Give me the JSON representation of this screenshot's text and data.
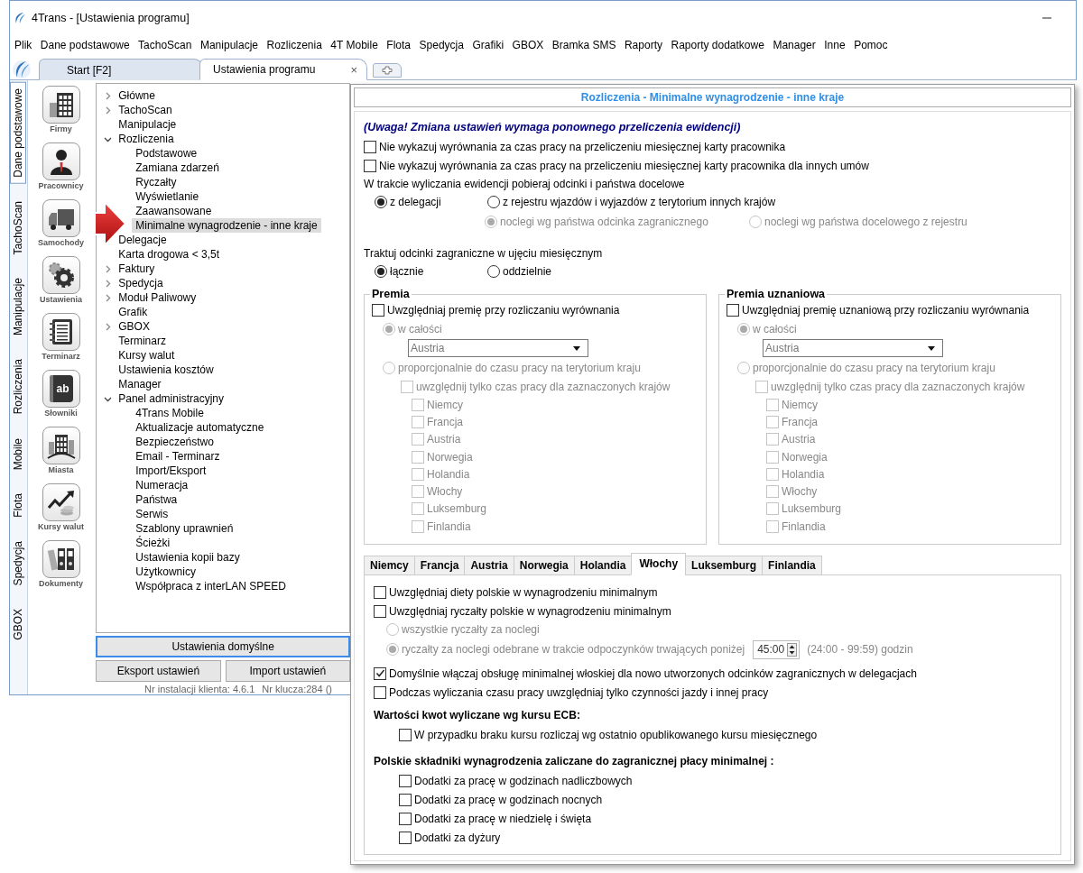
{
  "window": {
    "title": "4Trans - [Ustawienia programu]"
  },
  "menu": [
    "Plik",
    "Dane podstawowe",
    "TachoScan",
    "Manipulacje",
    "Rozliczenia",
    "4T Mobile",
    "Flota",
    "Spedycja",
    "Grafiki",
    "GBOX",
    "Bramka SMS",
    "Raporty",
    "Raporty dodatkowe",
    "Manager",
    "Inne",
    "Pomoc"
  ],
  "tabs": [
    {
      "label": "Start [F2]",
      "selected": false
    },
    {
      "label": "Ustawienia programu",
      "selected": true,
      "close": "×"
    }
  ],
  "side_tabs": [
    {
      "label": "Dane podstawowe",
      "selected": true
    },
    {
      "label": "TachoScan",
      "selected": false
    },
    {
      "label": "Manipulacje",
      "selected": false
    },
    {
      "label": "Rozliczenia",
      "selected": false
    },
    {
      "label": "Mobile",
      "selected": false
    },
    {
      "label": "Flota",
      "selected": false
    },
    {
      "label": "Spedycja",
      "selected": false
    },
    {
      "label": "GBOX",
      "selected": false
    }
  ],
  "modules": [
    {
      "label": "Firmy",
      "kind": "building"
    },
    {
      "label": "Pracownicy",
      "kind": "person"
    },
    {
      "label": "Samochody",
      "kind": "truck"
    },
    {
      "label": "Ustawienia",
      "kind": "gear"
    },
    {
      "label": "Terminarz",
      "kind": "notebook"
    },
    {
      "label": "Słowniki",
      "kind": "book",
      "badge": "ab"
    },
    {
      "label": "Miasta",
      "kind": "city"
    },
    {
      "label": "Kursy walut",
      "kind": "chart"
    },
    {
      "label": "Dokumenty",
      "kind": "binders"
    }
  ],
  "tree": [
    {
      "label": "Główne",
      "expanded": false,
      "selected": false
    },
    {
      "label": "TachoScan",
      "expanded": false,
      "selected": false
    },
    {
      "label": "Manipulacje",
      "selected": false
    },
    {
      "label": "Rozliczenia",
      "expanded": true,
      "selected": false,
      "children": [
        {
          "label": "Podstawowe",
          "selected": false
        },
        {
          "label": "Zamiana zdarzeń",
          "selected": false
        },
        {
          "label": "Ryczałty",
          "selected": false
        },
        {
          "label": "Wyświetlanie",
          "selected": false
        },
        {
          "label": "Zaawansowane",
          "selected": false
        },
        {
          "label": "Minimalne wynagrodzenie - inne kraje",
          "selected": true
        }
      ]
    },
    {
      "label": "Delegacje",
      "selected": false
    },
    {
      "label": "Karta drogowa < 3,5t",
      "selected": false
    },
    {
      "label": "Faktury",
      "expanded": false,
      "selected": false
    },
    {
      "label": "Spedycja",
      "expanded": false,
      "selected": false
    },
    {
      "label": "Moduł Paliwowy",
      "expanded": false,
      "selected": false
    },
    {
      "label": "Grafik",
      "selected": false
    },
    {
      "label": "GBOX",
      "expanded": false,
      "selected": false
    },
    {
      "label": "Terminarz",
      "selected": false
    },
    {
      "label": "Kursy walut",
      "selected": false
    },
    {
      "label": "Ustawienia kosztów",
      "selected": false
    },
    {
      "label": "Manager",
      "selected": false
    },
    {
      "label": "Panel administracyjny",
      "expanded": true,
      "selected": false,
      "children": [
        {
          "label": "4Trans Mobile",
          "selected": false
        },
        {
          "label": "Aktualizacje automatyczne",
          "selected": false
        },
        {
          "label": "Bezpieczeństwo",
          "selected": false
        },
        {
          "label": "Email - Terminarz",
          "selected": false
        },
        {
          "label": "Import/Eksport",
          "selected": false
        },
        {
          "label": "Numeracja",
          "selected": false
        },
        {
          "label": "Państwa",
          "selected": false
        },
        {
          "label": "Serwis",
          "selected": false
        },
        {
          "label": "Szablony uprawnień",
          "selected": false
        },
        {
          "label": "Ścieżki",
          "selected": false
        },
        {
          "label": "Ustawienia kopii bazy",
          "selected": false
        },
        {
          "label": "Użytkownicy",
          "selected": false
        },
        {
          "label": "Współpraca z interLAN SPEED",
          "selected": false
        }
      ]
    }
  ],
  "buttons": {
    "defaults": "Ustawienia domyślne",
    "export": "Eksport ustawień",
    "import": "Import ustawień"
  },
  "status_bar": {
    "install": "Nr instalacji klienta: 4.6.1",
    "key": "Nr klucza:284 ()"
  },
  "panel": {
    "title": "Rozliczenia - Minimalne wynagrodzenie - inne kraje",
    "warning": "(Uwaga! Zmiana ustawień wymaga ponownego przeliczenia ewidencji)",
    "options": [
      {
        "label": "Nie wykazuj wyrównania za czas pracy na przeliczeniu miesięcznej karty pracownika",
        "checked": false
      },
      {
        "label": "Nie wykazuj wyrównania za czas pracy na przeliczeniu miesięcznej karty pracownika dla innych umów",
        "checked": false
      }
    ],
    "source_label": "W trakcie wyliczania ewidencji pobieraj odcinki i państwa docelowe",
    "source_options": [
      {
        "label": "z delegacji",
        "selected": true
      },
      {
        "label": "z rejestru wjazdów i wyjazdów z terytorium innych krajów",
        "selected": false
      }
    ],
    "source_sub": [
      {
        "label": "noclegi wg państwa odcinka zagranicznego",
        "selected": true,
        "disabled": true
      },
      {
        "label": "noclegi wg państwa docelowego z rejestru",
        "selected": false,
        "disabled": true
      }
    ],
    "monthly_label": "Traktuj odcinki zagraniczne w ujęciu miesięcznym",
    "monthly_options": [
      {
        "label": "łącznie",
        "selected": true
      },
      {
        "label": "oddzielnie",
        "selected": false
      }
    ],
    "groups": [
      {
        "title": "Premia",
        "include": {
          "label": "Uwzględniaj premię przy rozliczaniu wyrównania",
          "checked": false
        },
        "whole": {
          "label": "w całości",
          "selected": true,
          "disabled": true
        },
        "dropdown": "Austria",
        "proportional": {
          "label": "proporcjonalnie do czasu pracy na terytorium kraju",
          "selected": false,
          "disabled": true
        },
        "only_marked": {
          "label": "uwzględnij tylko czas pracy dla zaznaczonych krajów",
          "checked": false,
          "disabled": true
        },
        "countries": [
          {
            "label": "Niemcy",
            "checked": false
          },
          {
            "label": "Francja",
            "checked": false
          },
          {
            "label": "Austria",
            "checked": false
          },
          {
            "label": "Norwegia",
            "checked": false
          },
          {
            "label": "Holandia",
            "checked": false
          },
          {
            "label": "Włochy",
            "checked": false
          },
          {
            "label": "Luksemburg",
            "checked": false
          },
          {
            "label": "Finlandia",
            "checked": false
          }
        ]
      },
      {
        "title": "Premia uznaniowa",
        "include": {
          "label": "Uwzględniaj premię uznaniową przy rozliczaniu wyrównania",
          "checked": false
        },
        "whole": {
          "label": "w całości",
          "selected": true,
          "disabled": true
        },
        "dropdown": "Austria",
        "proportional": {
          "label": "proporcjonalnie do czasu pracy na terytorium kraju",
          "selected": false,
          "disabled": true
        },
        "only_marked": {
          "label": "uwzględnij tylko czas pracy dla zaznaczonych krajów",
          "checked": false,
          "disabled": true
        },
        "countries": [
          {
            "label": "Niemcy",
            "checked": false
          },
          {
            "label": "Francja",
            "checked": false
          },
          {
            "label": "Austria",
            "checked": false
          },
          {
            "label": "Norwegia",
            "checked": false
          },
          {
            "label": "Holandia",
            "checked": false
          },
          {
            "label": "Włochy",
            "checked": false
          },
          {
            "label": "Luksemburg",
            "checked": false
          },
          {
            "label": "Finlandia",
            "checked": false
          }
        ]
      }
    ],
    "country_tabs": [
      {
        "label": "Niemcy",
        "selected": false
      },
      {
        "label": "Francja",
        "selected": false
      },
      {
        "label": "Austria",
        "selected": false
      },
      {
        "label": "Norwegia",
        "selected": false
      },
      {
        "label": "Holandia",
        "selected": false
      },
      {
        "label": "Włochy",
        "selected": true
      },
      {
        "label": "Luksemburg",
        "selected": false
      },
      {
        "label": "Finlandia",
        "selected": false
      }
    ],
    "tab_content": {
      "diets": {
        "label": "Uwzględniaj diety polskie w wynagrodzeniu minimalnym",
        "checked": false
      },
      "lump": {
        "label": "Uwzględniaj ryczałty polskie w wynagrodzeniu minimalnym",
        "checked": false
      },
      "lump_all": {
        "label": "wszystkie ryczałty za noclegi",
        "selected": false,
        "disabled": true
      },
      "lump_rest": {
        "label": "ryczałty za noclegi odebrane w trakcie odpoczynków trwających poniżej",
        "selected": true,
        "disabled": true
      },
      "hours": "45:00",
      "hours_range": "(24:00 - 99:59) godzin",
      "default_on": {
        "label": "Domyślnie włączaj obsługę minimalnej włoskiej dla nowo utworzonych odcinków zagranicznych w delegacjach",
        "checked": true
      },
      "only_driving": {
        "label": "Podczas wyliczania czasu pracy uwzględniaj tylko czynności jazdy i innej pracy",
        "checked": false
      },
      "ecb_heading": "Wartości kwot wyliczane wg kursu ECB:",
      "ecb_option": {
        "label": "W przypadku braku kursu rozliczaj wg ostatnio opublikowanego kursu miesięcznego",
        "checked": false
      },
      "components_heading": "Polskie składniki wynagrodzenia zaliczane do zagranicznej płacy minimalnej :",
      "components": [
        {
          "label": "Dodatki za pracę w godzinach nadliczbowych",
          "checked": false
        },
        {
          "label": "Dodatki za pracę w godzinach nocnych",
          "checked": false
        },
        {
          "label": "Dodatki za pracę w niedzielę i święta",
          "checked": false
        },
        {
          "label": "Dodatki za dyżury",
          "checked": false
        }
      ]
    }
  }
}
